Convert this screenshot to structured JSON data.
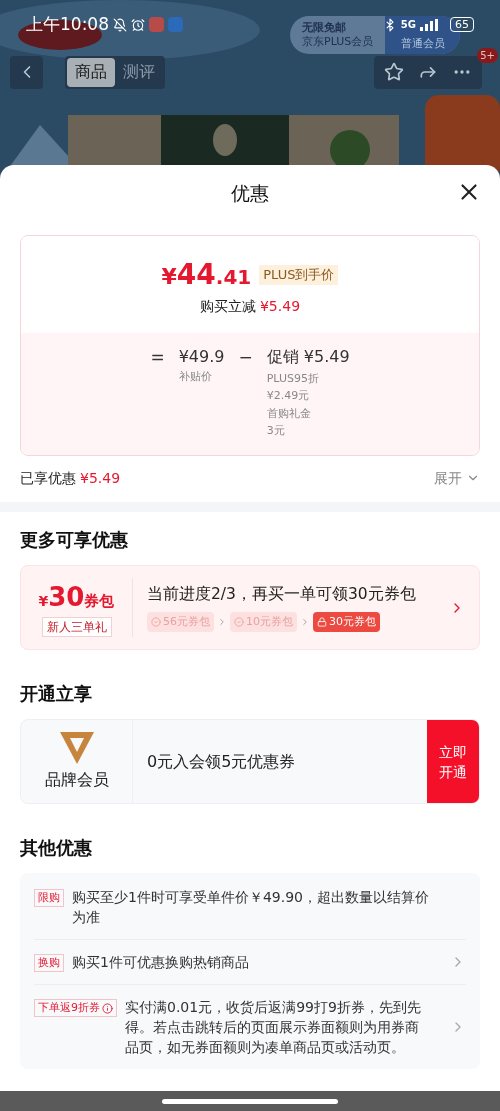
{
  "status_bar": {
    "time": "上午10:08",
    "network": "5G",
    "battery": "65"
  },
  "product_nav": {
    "tabs": [
      {
        "label": "商品",
        "selected": true
      },
      {
        "label": "测评",
        "selected": false
      }
    ],
    "badge": "5+"
  },
  "plus_banner": {
    "title": "无限免邮",
    "subtitle": "京东PLUS会员",
    "tier": "普通会员"
  },
  "sheet": {
    "title": "优惠"
  },
  "price_card": {
    "currency": "¥",
    "price_int": "44",
    "price_dec": ".41",
    "tag": "PLUS到手价",
    "reduce_label": "购买立减",
    "reduce_value": "¥5.49",
    "equals": "=",
    "base_price": "¥49.9",
    "base_label": "补贴价",
    "minus": "−",
    "promo_label": "促销",
    "promo_value": "¥5.49",
    "promo_items": [
      {
        "name": "PLUS95折",
        "value": "¥2.49元"
      },
      {
        "name": "首购礼金",
        "value": "3元"
      }
    ]
  },
  "enjoyed": {
    "label": "已享优惠",
    "value": "¥5.49",
    "expand": "展开"
  },
  "more_offers": {
    "heading": "更多可享优惠",
    "currency": "¥",
    "amount": "30",
    "unit": "券包",
    "badge": "新人三单礼",
    "title": "当前进度2/3，再买一单可领30元券包",
    "steps": [
      {
        "label": "56元券包",
        "kind": "done"
      },
      {
        "label": "10元券包",
        "kind": "done"
      },
      {
        "label": "30元券包",
        "kind": "locked"
      }
    ]
  },
  "membership": {
    "heading": "开通立享",
    "name": "品牌会员",
    "offer": "0元入会领5元优惠券",
    "button": "立即开通"
  },
  "other_offers": {
    "heading": "其他优惠",
    "items": [
      {
        "tag": "限购",
        "text": "购买至少1件时可享受单件价￥49.90，超出数量以结算价为准",
        "info": false,
        "has_arrow": false
      },
      {
        "tag": "换购",
        "text": "购买1件可优惠换购热销商品",
        "info": false,
        "has_arrow": true
      },
      {
        "tag": "下单返9折券",
        "text": "实付满0.01元，收货后返满99打9折券，先到先得。若点击跳转后的页面展示券面额则为用券商品页，如无券面额则为凑单商品页或活动页。",
        "info": true,
        "has_arrow": true
      }
    ]
  }
}
